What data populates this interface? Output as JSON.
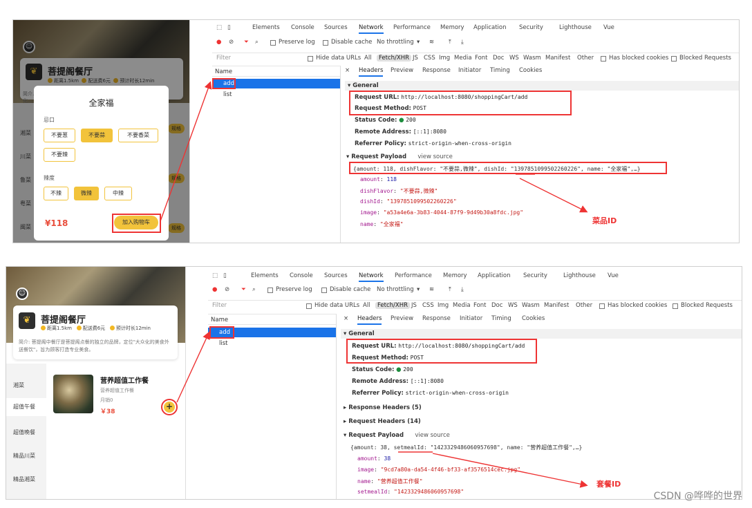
{
  "top": {
    "shop": {
      "name": "菩提阁餐厅",
      "distance": "距离1.5km",
      "delivery_fee": "配送费6元",
      "eta": "预计时长12min",
      "intro_snippet": "简介…",
      "intro_snippet2": "化…"
    },
    "sidebar": [
      "湘菜",
      "川菜",
      "鲁菜",
      "粤菜",
      "闽菜"
    ],
    "spec_button": "规格",
    "dialog": {
      "title": "全家福",
      "group1_label": "忌口",
      "group1_options": [
        "不要葱",
        "不要蒜",
        "不要香菜",
        "不要辣"
      ],
      "group2_label": "辣度",
      "group2_options": [
        "不辣",
        "微辣",
        "中辣"
      ],
      "price": "¥118",
      "add_cart": "加入购物车"
    },
    "devtools": {
      "tabs": [
        "Elements",
        "Console",
        "Sources",
        "Network",
        "Performance",
        "Memory",
        "Application",
        "Security",
        "Lighthouse",
        "Vue"
      ],
      "preserve_log": "Preserve log",
      "disable_cache": "Disable cache",
      "throttling": "No throttling",
      "filter_placeholder": "Filter",
      "hide_data_urls": "Hide data URLs",
      "filter_types": [
        "All",
        "Fetch/XHR",
        "JS",
        "CSS",
        "Img",
        "Media",
        "Font",
        "Doc",
        "WS",
        "Wasm",
        "Manifest",
        "Other"
      ],
      "has_blocked_cookies": "Has blocked cookies",
      "blocked_requests": "Blocked Requests",
      "name_header": "Name",
      "requests": [
        "add",
        "list"
      ],
      "detail_tabs": [
        "Headers",
        "Preview",
        "Response",
        "Initiator",
        "Timing",
        "Cookies"
      ],
      "general": "General",
      "request_url_label": "Request URL:",
      "request_url": "http://localhost:8080/shoppingCart/add",
      "request_method_label": "Request Method:",
      "request_method": "POST",
      "status_code_label": "Status Code:",
      "status_code": "200",
      "remote_address_label": "Remote Address:",
      "remote_address": "[::1]:8080",
      "referrer_policy_label": "Referrer Policy:",
      "referrer_policy": "strict-origin-when-cross-origin",
      "request_payload": "Request Payload",
      "view_source": "view source",
      "payload_summary": "{amount: 118, dishFlavor: \"不要蒜,微辣\", dishId: \"1397851099502260226\", name: \"全家福\",…}",
      "payload_fields": [
        {
          "key": "amount",
          "value": "118",
          "kind": "num"
        },
        {
          "key": "dishFlavor",
          "value": "\"不要蒜,微辣\"",
          "kind": "str"
        },
        {
          "key": "dishId",
          "value": "\"1397851099502260226\"",
          "kind": "str"
        },
        {
          "key": "image",
          "value": "\"a53a4e6a-3b83-4044-87f9-9d49b30a8fdc.jpg\"",
          "kind": "str"
        },
        {
          "key": "name",
          "value": "\"全家福\"",
          "kind": "str"
        }
      ]
    },
    "annotation": "菜品ID"
  },
  "bottom": {
    "shop": {
      "name": "菩提阁餐厅",
      "distance": "距离1.5km",
      "delivery_fee": "配送费6元",
      "eta": "预计时长12min",
      "intro": "简介: 菩提阁中餐厅是菩提阁点餐的独立的品牌，定位\"大众化的美食外送餐饮\"，旨为顾客打造专业美食。"
    },
    "sidebar": [
      "湘菜",
      "超值午餐",
      "超值晚餐",
      "精品川菜",
      "精品湘菜"
    ],
    "dish": {
      "name": "营养超值工作餐",
      "desc": "营养超值工作餐",
      "sales": "月销0",
      "price": "￥38",
      "plus": "+"
    },
    "devtools": {
      "tabs": [
        "Elements",
        "Console",
        "Sources",
        "Network",
        "Performance",
        "Memory",
        "Application",
        "Security",
        "Lighthouse",
        "Vue"
      ],
      "preserve_log": "Preserve log",
      "disable_cache": "Disable cache",
      "throttling": "No throttling",
      "filter_placeholder": "Filter",
      "hide_data_urls": "Hide data URLs",
      "filter_types": [
        "All",
        "Fetch/XHR",
        "JS",
        "CSS",
        "Img",
        "Media",
        "Font",
        "Doc",
        "WS",
        "Wasm",
        "Manifest",
        "Other"
      ],
      "has_blocked_cookies": "Has blocked cookies",
      "blocked_requests": "Blocked Requests",
      "name_header": "Name",
      "requests": [
        "add",
        "list"
      ],
      "detail_tabs": [
        "Headers",
        "Preview",
        "Response",
        "Initiator",
        "Timing",
        "Cookies"
      ],
      "general": "General",
      "request_url_label": "Request URL:",
      "request_url": "http://localhost:8080/shoppingCart/add",
      "request_method_label": "Request Method:",
      "request_method": "POST",
      "status_code_label": "Status Code:",
      "status_code": "200",
      "remote_address_label": "Remote Address:",
      "remote_address": "[::1]:8080",
      "referrer_policy_label": "Referrer Policy:",
      "referrer_policy": "strict-origin-when-cross-origin",
      "response_headers": "Response Headers (5)",
      "request_headers": "Request Headers (14)",
      "request_payload": "Request Payload",
      "view_source": "view source",
      "payload_summary": "{amount: 38, setmealId: \"1423329486060957698\", name: \"营养超值工作餐\",…}",
      "payload_fields": [
        {
          "key": "amount",
          "value": "38",
          "kind": "num"
        },
        {
          "key": "image",
          "value": "\"9cd7a80a-da54-4f46-bf33-af3576514cec.jpg\"",
          "kind": "str"
        },
        {
          "key": "name",
          "value": "\"营养超值工作餐\"",
          "kind": "str"
        },
        {
          "key": "setmealId",
          "value": "\"1423329486060957698\"",
          "kind": "str"
        }
      ]
    },
    "annotation": "套餐ID"
  },
  "watermark": "CSDN @哗哗的世界",
  "colors": {
    "accent": "#f2c33b",
    "highlight": "#e33333",
    "selected": "#1a73e8"
  }
}
